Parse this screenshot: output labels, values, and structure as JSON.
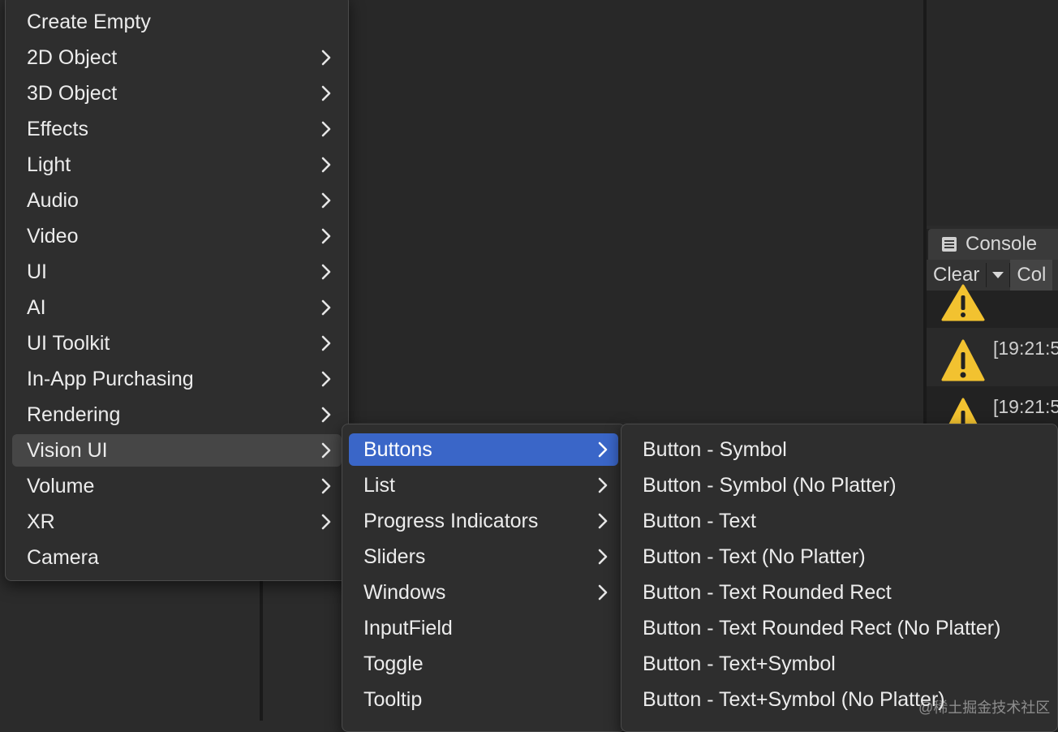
{
  "colors": {
    "selected": "#3a66c8",
    "hover": "#464646",
    "warning": "#f2c230"
  },
  "main_menu": {
    "items": [
      {
        "label": "Create Empty",
        "has_submenu": false
      },
      {
        "label": "2D Object",
        "has_submenu": true
      },
      {
        "label": "3D Object",
        "has_submenu": true
      },
      {
        "label": "Effects",
        "has_submenu": true
      },
      {
        "label": "Light",
        "has_submenu": true
      },
      {
        "label": "Audio",
        "has_submenu": true
      },
      {
        "label": "Video",
        "has_submenu": true
      },
      {
        "label": "UI",
        "has_submenu": true
      },
      {
        "label": "AI",
        "has_submenu": true
      },
      {
        "label": "UI Toolkit",
        "has_submenu": true
      },
      {
        "label": "In-App Purchasing",
        "has_submenu": true
      },
      {
        "label": "Rendering",
        "has_submenu": true
      },
      {
        "label": "Vision UI",
        "has_submenu": true,
        "state": "hover"
      },
      {
        "label": "Volume",
        "has_submenu": true
      },
      {
        "label": "XR",
        "has_submenu": true
      },
      {
        "label": "Camera",
        "has_submenu": false
      }
    ]
  },
  "vision_ui_menu": {
    "items": [
      {
        "label": "Buttons",
        "has_submenu": true,
        "state": "selected"
      },
      {
        "label": "List",
        "has_submenu": true
      },
      {
        "label": "Progress Indicators",
        "has_submenu": true
      },
      {
        "label": "Sliders",
        "has_submenu": true
      },
      {
        "label": "Windows",
        "has_submenu": true
      },
      {
        "label": "InputField",
        "has_submenu": false
      },
      {
        "label": "Toggle",
        "has_submenu": false
      },
      {
        "label": "Tooltip",
        "has_submenu": false
      }
    ]
  },
  "buttons_menu": {
    "items": [
      {
        "label": "Button - Symbol"
      },
      {
        "label": "Button - Symbol (No Platter)"
      },
      {
        "label": "Button - Text"
      },
      {
        "label": "Button - Text (No Platter)"
      },
      {
        "label": "Button - Text Rounded Rect"
      },
      {
        "label": "Button - Text Rounded Rect (No Platter)"
      },
      {
        "label": "Button - Text+Symbol"
      },
      {
        "label": "Button - Text+Symbol (No Platter)"
      }
    ]
  },
  "console": {
    "tab_label": "Console",
    "tab_icon": "console-icon",
    "clear_label": "Clear",
    "collapse_label": "Col",
    "logs": [
      {
        "time": "[19:21:5",
        "icon": "warning-icon"
      },
      {
        "time": "[19:21:5",
        "icon": "warning-icon"
      }
    ]
  },
  "watermark": "@稀土掘金技术社区"
}
